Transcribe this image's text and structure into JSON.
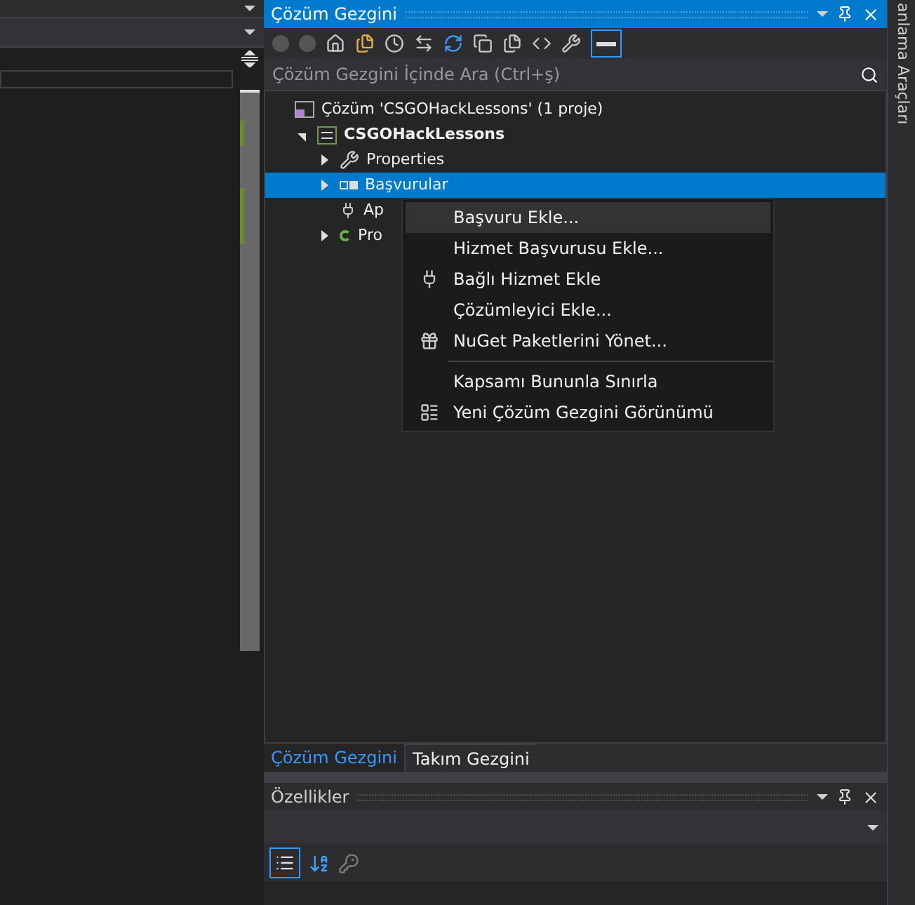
{
  "solution_explorer": {
    "title": "Çözüm Gezgini",
    "search": {
      "placeholder": "Çözüm Gezgini İçinde Ara (Ctrl+ş)"
    },
    "tree": [
      {
        "kind": "solution",
        "label": "Çözüm 'CSGOHackLessons' (1 proje)",
        "selected": false,
        "children": [
          {
            "kind": "project",
            "label": "CSGOHackLessons",
            "expanded": true,
            "selected": false,
            "children": [
              {
                "kind": "properties",
                "label": "Properties",
                "expanded": false,
                "selected": false
              },
              {
                "kind": "references",
                "label": "Başvurular",
                "expanded": false,
                "selected": true
              },
              {
                "kind": "config",
                "label": "Ap",
                "selected": false
              },
              {
                "kind": "csharp",
                "label": "Pro",
                "expanded": false,
                "selected": false
              }
            ]
          }
        ]
      }
    ],
    "context_menu": [
      {
        "kind": "item",
        "label": "Başvuru Ekle...",
        "selected": true
      },
      {
        "kind": "item",
        "label": "Hizmet Başvurusu Ekle...",
        "selected": false
      },
      {
        "kind": "item",
        "label": "Bağlı Hizmet Ekle",
        "selected": false
      },
      {
        "kind": "item",
        "label": "Çözümleyici Ekle...",
        "selected": false
      },
      {
        "kind": "item",
        "label": "NuGet Paketlerini Yönet...",
        "selected": false
      },
      {
        "kind": "separator"
      },
      {
        "kind": "item",
        "label": "Kapsamı Bununla Sınırla",
        "selected": false
      },
      {
        "kind": "item",
        "label": "Yeni Çözüm Gezgini Görünümü",
        "selected": false
      }
    ],
    "tabs": [
      {
        "label": "Çözüm Gezgini",
        "selected": true
      },
      {
        "label": "Takım Gezgini",
        "selected": false
      }
    ]
  },
  "properties": {
    "title": "Özellikler"
  },
  "side_strip": {
    "label": "anlama Araçları"
  }
}
